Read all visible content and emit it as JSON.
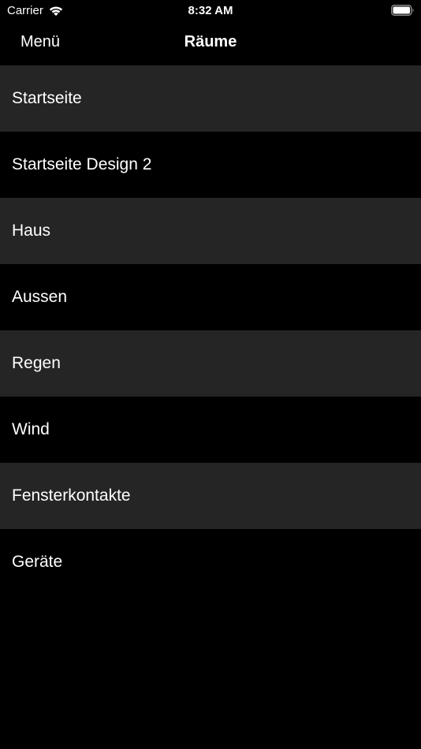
{
  "status_bar": {
    "carrier": "Carrier",
    "time": "8:32 AM",
    "wifi_icon": "wifi-icon",
    "battery_icon": "battery-icon"
  },
  "nav": {
    "back_label": "Menü",
    "title": "Räume"
  },
  "rooms": [
    {
      "label": "Startseite"
    },
    {
      "label": "Startseite Design 2"
    },
    {
      "label": "Haus"
    },
    {
      "label": "Aussen"
    },
    {
      "label": "Regen"
    },
    {
      "label": "Wind"
    },
    {
      "label": "Fensterkontakte"
    },
    {
      "label": "Geräte"
    }
  ],
  "colors": {
    "background": "#000000",
    "row_alt": "#252525",
    "text": "#ffffff"
  }
}
